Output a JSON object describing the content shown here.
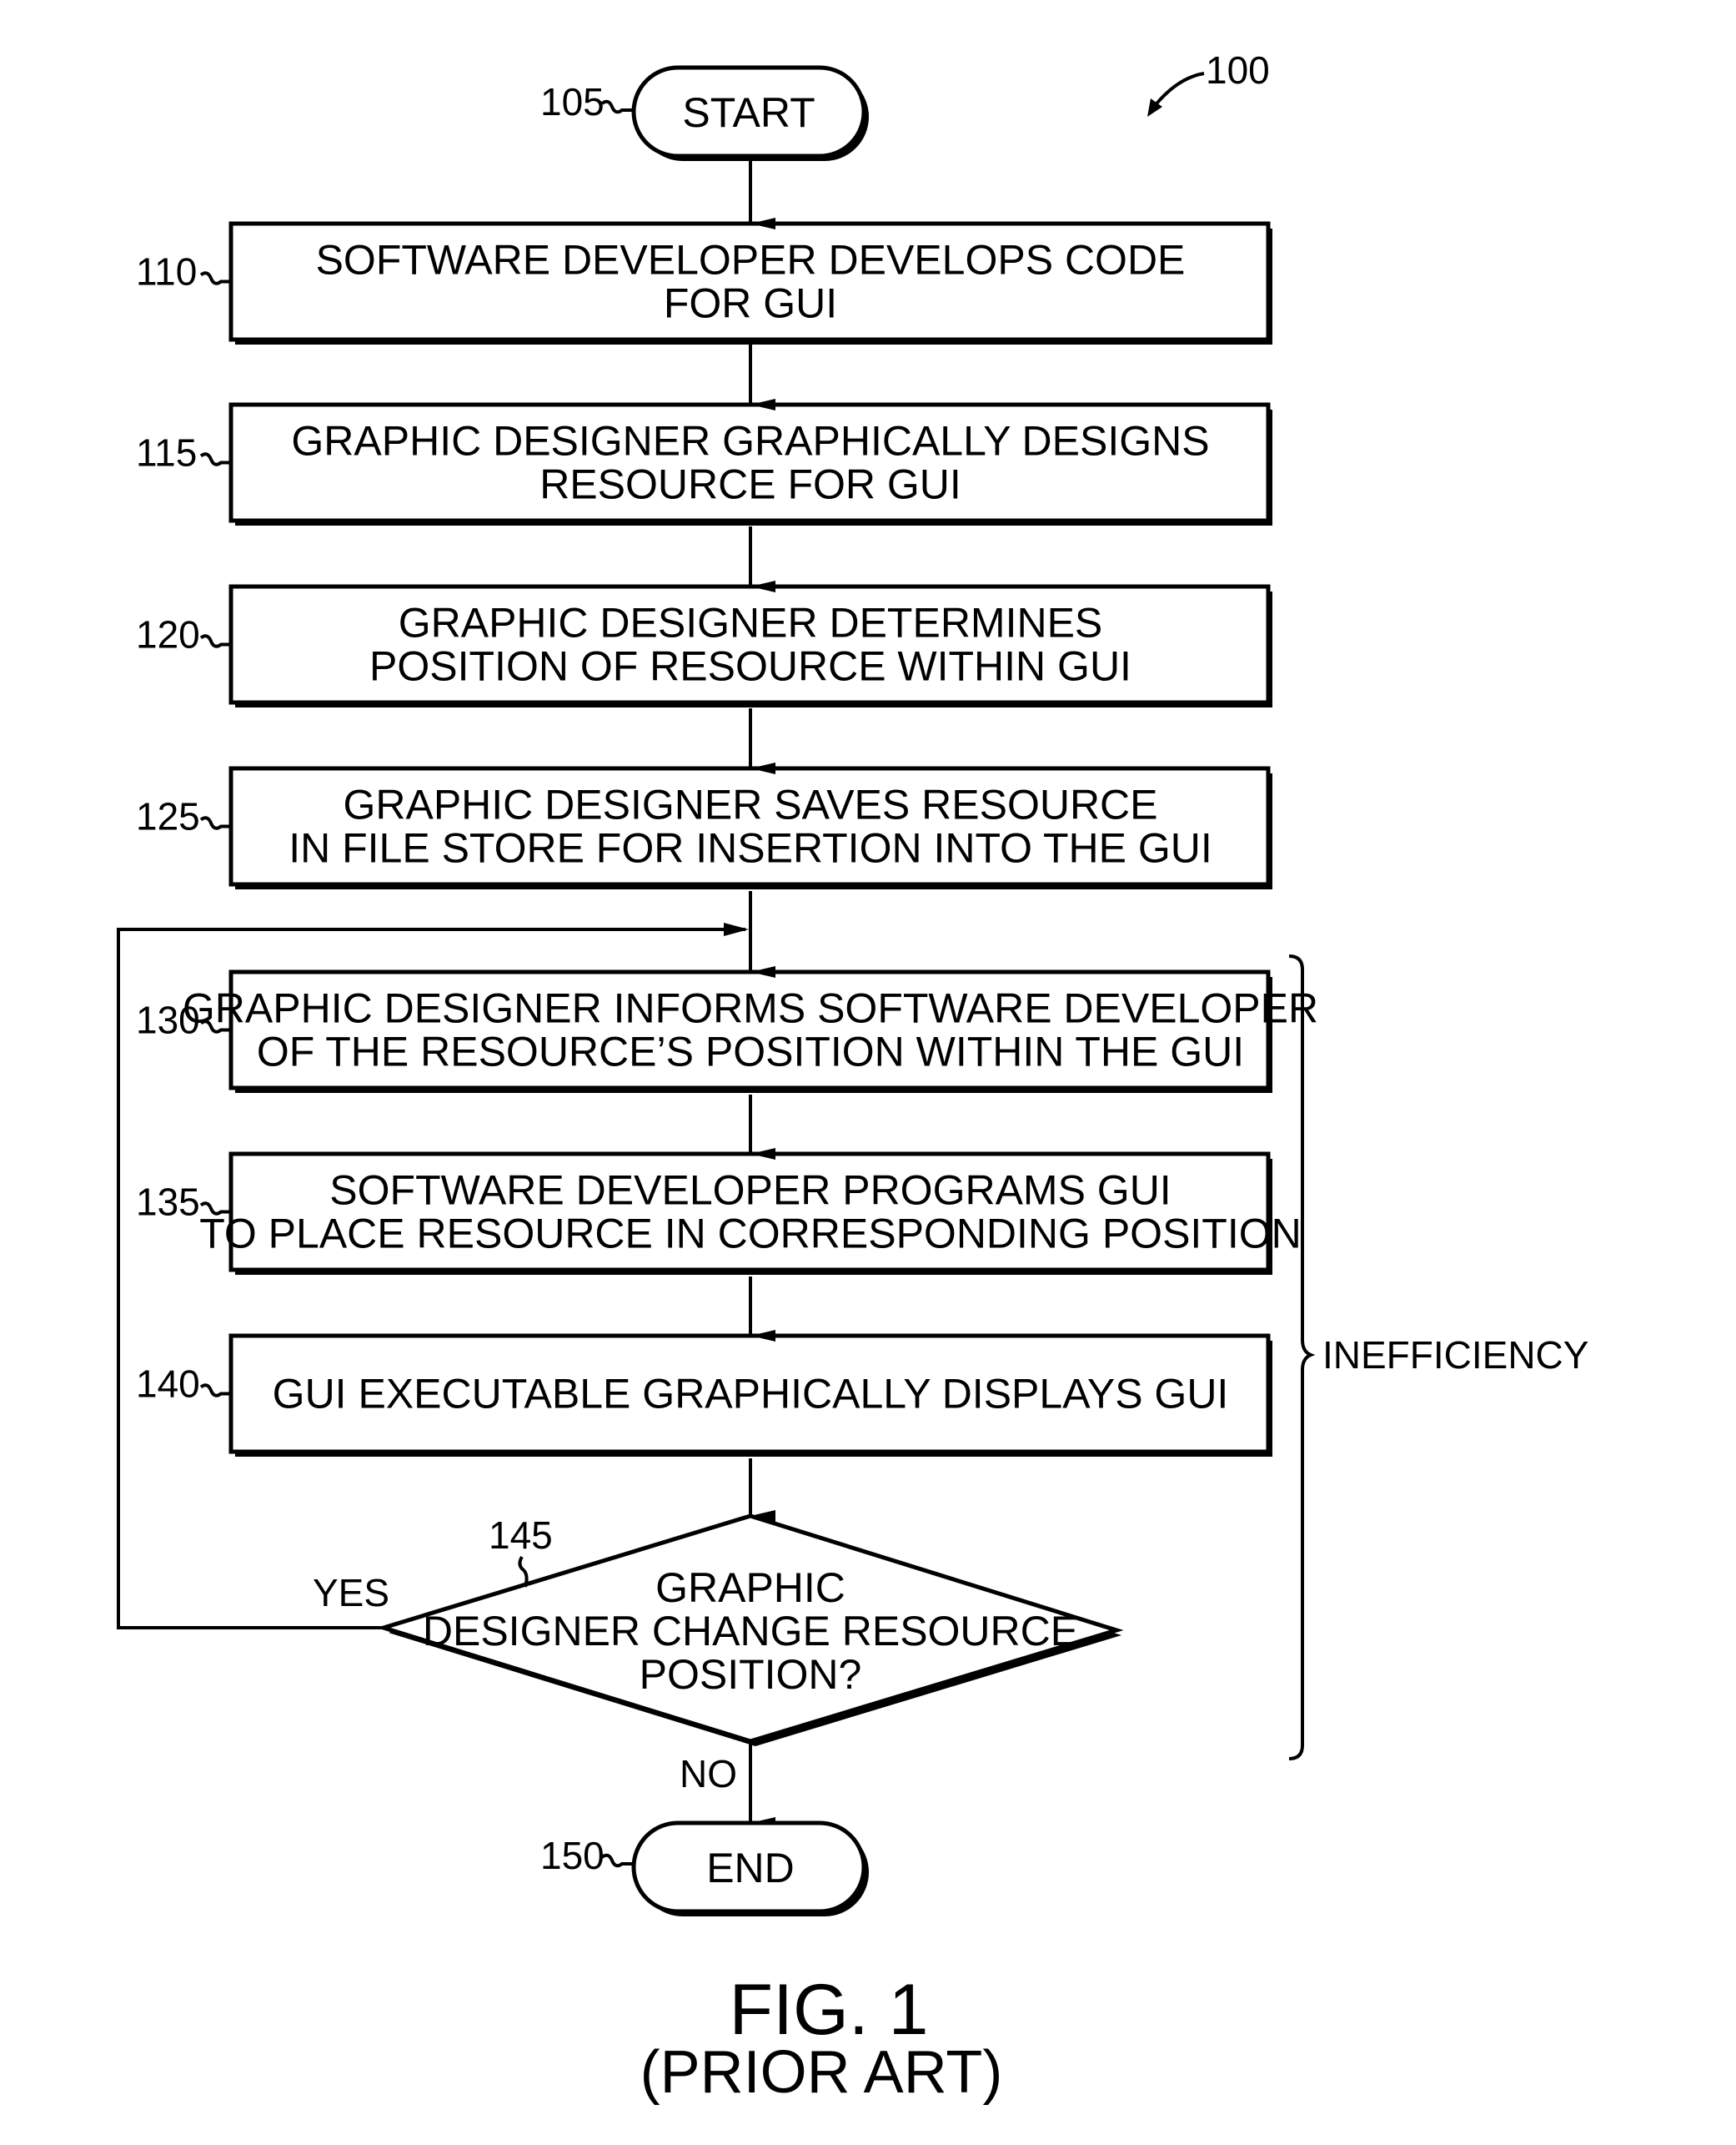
{
  "figure": {
    "reference": "100",
    "caption": "FIG. 1",
    "subcaption": "(PRIOR ART)"
  },
  "start": {
    "ref": "105",
    "label": "START"
  },
  "end": {
    "ref": "150",
    "label": "END"
  },
  "steps": [
    {
      "ref": "110",
      "lines": [
        "SOFTWARE DEVELOPER DEVELOPS CODE",
        "FOR GUI"
      ]
    },
    {
      "ref": "115",
      "lines": [
        "GRAPHIC DESIGNER GRAPHICALLY DESIGNS",
        "RESOURCE FOR GUI"
      ]
    },
    {
      "ref": "120",
      "lines": [
        "GRAPHIC DESIGNER DETERMINES",
        "POSITION OF RESOURCE WITHIN GUI"
      ]
    },
    {
      "ref": "125",
      "lines": [
        "GRAPHIC DESIGNER SAVES RESOURCE",
        "IN FILE STORE FOR INSERTION INTO THE GUI"
      ]
    },
    {
      "ref": "130",
      "lines": [
        "GRAPHIC DESIGNER INFORMS SOFTWARE DEVELOPER",
        "OF THE RESOURCE’S POSITION WITHIN THE GUI"
      ]
    },
    {
      "ref": "135",
      "lines": [
        "SOFTWARE DEVELOPER PROGRAMS GUI",
        "TO PLACE RESOURCE IN CORRESPONDING POSITION"
      ]
    },
    {
      "ref": "140",
      "lines": [
        "GUI EXECUTABLE GRAPHICALLY DISPLAYS GUI"
      ]
    }
  ],
  "decision": {
    "ref": "145",
    "lines": [
      "GRAPHIC",
      "DESIGNER CHANGE RESOURCE",
      "POSITION?"
    ],
    "yes_label": "YES",
    "no_label": "NO"
  },
  "brace": {
    "label": "INEFFICIENCY"
  }
}
